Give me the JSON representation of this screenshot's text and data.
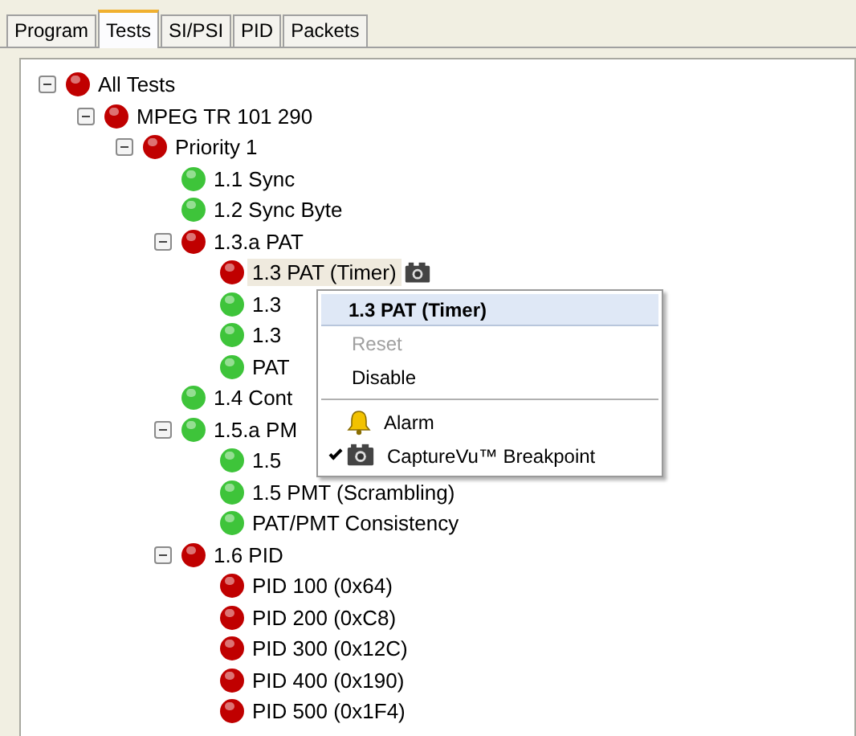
{
  "tabs": [
    {
      "label": "Program",
      "selected": false
    },
    {
      "label": "Tests",
      "selected": true
    },
    {
      "label": "SI/PSI",
      "selected": false
    },
    {
      "label": "PID",
      "selected": false
    },
    {
      "label": "Packets",
      "selected": false
    }
  ],
  "tree": [
    {
      "label": "All Tests",
      "color": "#c00000",
      "expanded": true,
      "children": [
        {
          "label": "MPEG TR 101 290",
          "color": "#c00000",
          "expanded": true,
          "children": [
            {
              "label": "Priority 1",
              "color": "#c00000",
              "expanded": true,
              "children": [
                {
                  "label": "1.1 Sync",
                  "color": "#3ec43a"
                },
                {
                  "label": "1.2 Sync Byte",
                  "color": "#3ec43a"
                },
                {
                  "label": "1.3.a PAT",
                  "color": "#c00000",
                  "expanded": true,
                  "children": [
                    {
                      "label": "1.3 PAT (Timer)",
                      "color": "#c00000",
                      "selected": true,
                      "breakpoint": true
                    },
                    {
                      "label": "1.3",
                      "color": "#3ec43a",
                      "selected": false
                    },
                    {
                      "label": "1.3",
                      "color": "#3ec43a",
                      "selected": false
                    },
                    {
                      "label": "PAT",
                      "color": "#3ec43a",
                      "selected": false
                    }
                  ]
                },
                {
                  "label": "1.4 Cont",
                  "color": "#3ec43a"
                },
                {
                  "label": "1.5.a PM",
                  "color": "#3ec43a",
                  "expanded": true,
                  "children": [
                    {
                      "label": "1.5",
                      "color": "#3ec43a"
                    },
                    {
                      "label": "1.5 PMT (Scrambling)",
                      "color": "#3ec43a"
                    },
                    {
                      "label": "PAT/PMT Consistency",
                      "color": "#3ec43a"
                    }
                  ]
                },
                {
                  "label": "1.6 PID",
                  "color": "#c00000",
                  "expanded": true,
                  "children": [
                    {
                      "label": "PID 100 (0x64)",
                      "color": "#c00000"
                    },
                    {
                      "label": "PID 200 (0xC8)",
                      "color": "#c00000"
                    },
                    {
                      "label": "PID 300 (0x12C)",
                      "color": "#c00000"
                    },
                    {
                      "label": "PID 400 (0x190)",
                      "color": "#c00000"
                    },
                    {
                      "label": "PID 500 (0x1F4)",
                      "color": "#c00000"
                    }
                  ]
                }
              ]
            }
          ]
        }
      ]
    }
  ],
  "context_menu": {
    "title": "1.3 PAT (Timer)",
    "items": [
      {
        "kind": "item",
        "label": "Reset",
        "disabled": true
      },
      {
        "kind": "item",
        "label": "Disable",
        "disabled": false
      },
      {
        "kind": "separator"
      },
      {
        "kind": "alarm",
        "label": "Alarm",
        "checked": false
      },
      {
        "kind": "camera",
        "label": "CaptureVu™ Breakpoint",
        "checked": true
      }
    ]
  }
}
